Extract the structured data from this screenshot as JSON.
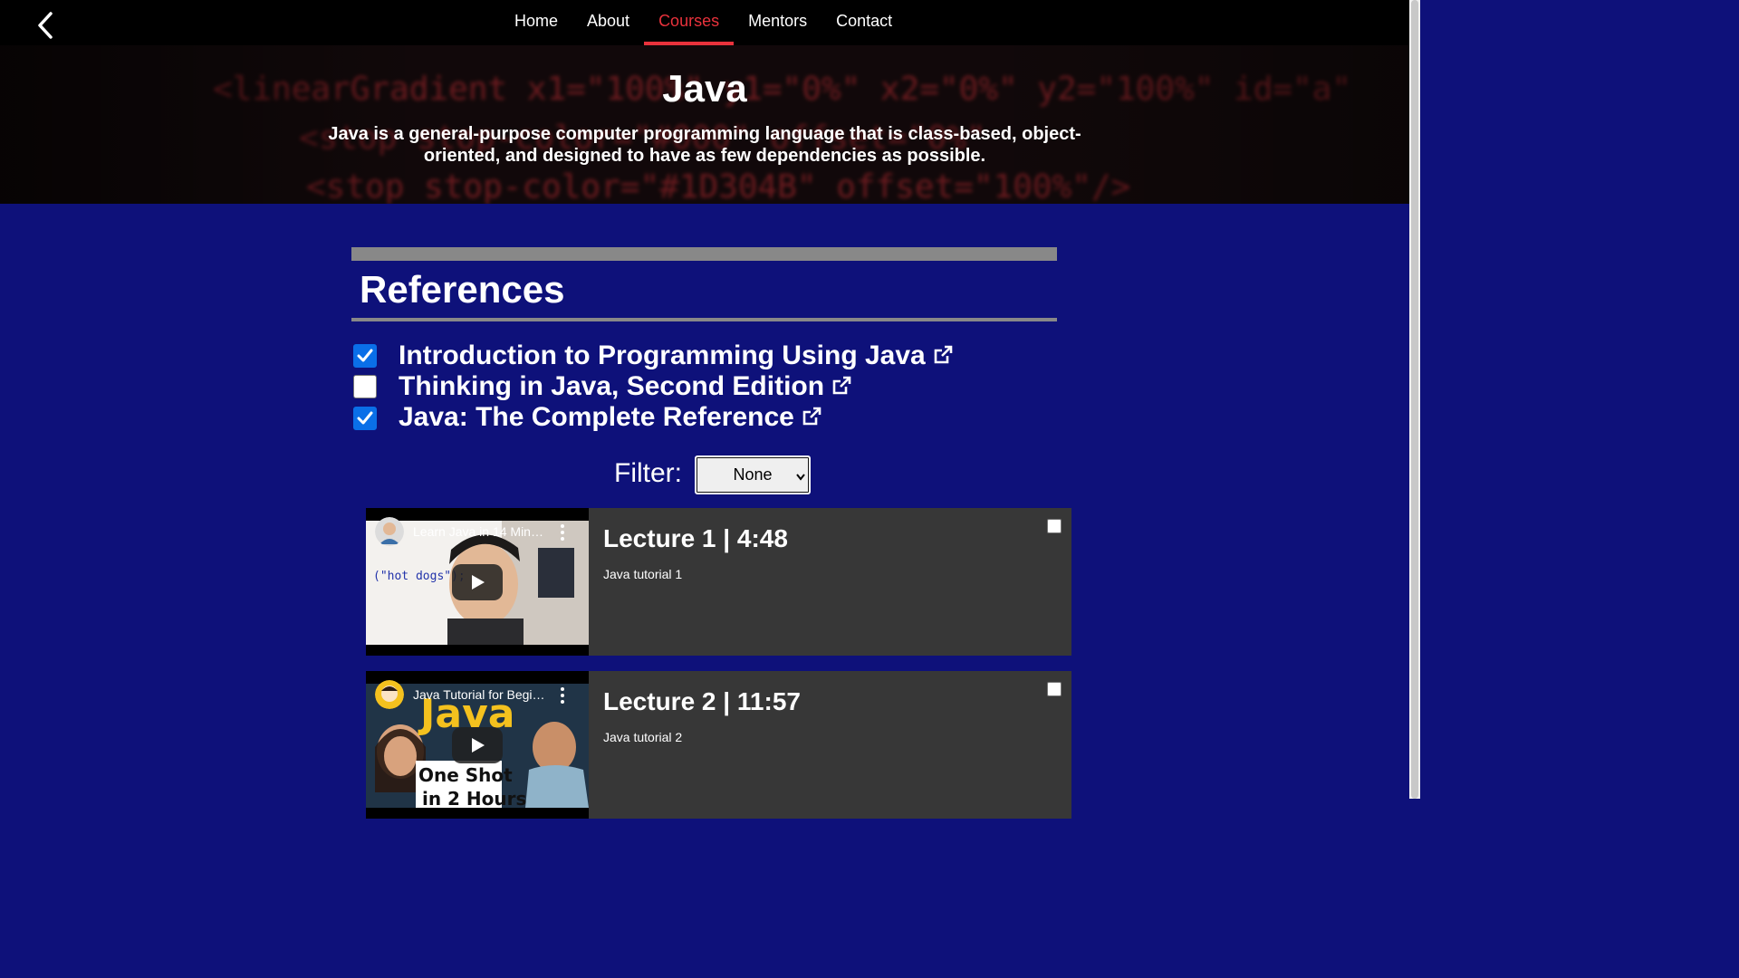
{
  "nav": {
    "back_label": "",
    "items": [
      {
        "label": "Home"
      },
      {
        "label": "About"
      },
      {
        "label": "Courses",
        "active": true
      },
      {
        "label": "Mentors"
      },
      {
        "label": "Contact"
      }
    ],
    "active_color": "#e9323c"
  },
  "hero": {
    "title": "Java",
    "description": "Java is a general-purpose computer programming language that is class-based, object-oriented, and designed to have as few dependencies as possible.",
    "background_code": {
      "line1": "<linearGradient x1=\"100%\" y1=\"0%\" x2=\"0%\" y2=\"100%\" id=\"a\"",
      "line2": "<stop stop-color=\"#000\" offset=\"0%\"",
      "line3": "<stop stop-color=\"#1D304B\" offset=\"100%\"/>"
    }
  },
  "references": {
    "title": "References",
    "items": [
      {
        "label": "Introduction to Programming Using Java",
        "checked": true
      },
      {
        "label": "Thinking in Java, Second Edition",
        "checked": false
      },
      {
        "label": "Java: The Complete Reference",
        "checked": true
      }
    ]
  },
  "filter": {
    "label": "Filter:",
    "selected": "None"
  },
  "lectures": [
    {
      "title": "Lecture 1 | 4:48",
      "description": "Java tutorial 1",
      "video_title": "Learn Java in 14 Minutes (seriously)",
      "thumb_text": "(\"hot dogs\");",
      "checked": false
    },
    {
      "title": "Lecture 2 | 11:57",
      "description": "Java tutorial 2",
      "video_title": "Java Tutorial for Beginners",
      "thumb_text_big": "Java",
      "thumb_text_small1": "One Shot",
      "thumb_text_small2": "in 2 Hours",
      "checked": false
    }
  ],
  "colors": {
    "page_bg": "#0e117a",
    "card_bg": "#373737",
    "checkbox_checked": "#0a6fe8",
    "divider": "#888888"
  }
}
